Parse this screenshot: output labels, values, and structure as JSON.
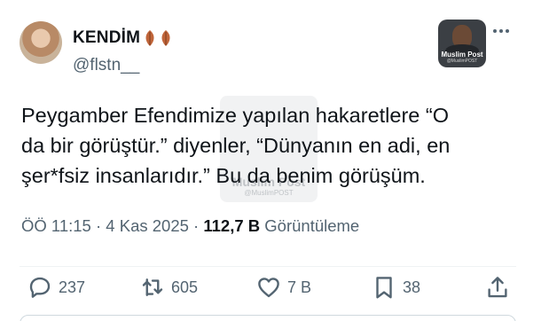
{
  "author": {
    "display_name": "KENDİM",
    "name_emoji": "leaf-icons",
    "handle": "@flstn__"
  },
  "channel_logo": {
    "name": "Muslim Post",
    "handle": "@MuslimPOST"
  },
  "watermark": {
    "name": "Muslim Post",
    "handle": "@MuslimPOST"
  },
  "tweet": {
    "lines": [
      "Peygamber Efendimize yapılan hakaretlere “O",
      "da bir görüştür.” diyenler, “Dünyanın en adi, en",
      "şer*fsiz insanlarıdır.” Bu da benim görüşüm."
    ]
  },
  "meta": {
    "time": "ÖÖ 11:15",
    "separator": "·",
    "date": "4 Kas 2025",
    "views_count": "112,7 B",
    "views_label": "Görüntüleme"
  },
  "actions": {
    "replies": "237",
    "reposts": "605",
    "likes": "7 B",
    "bookmarks": "38"
  },
  "colors": {
    "text": "#0f1419",
    "secondary": "#536471",
    "divider": "#eff3f4"
  }
}
